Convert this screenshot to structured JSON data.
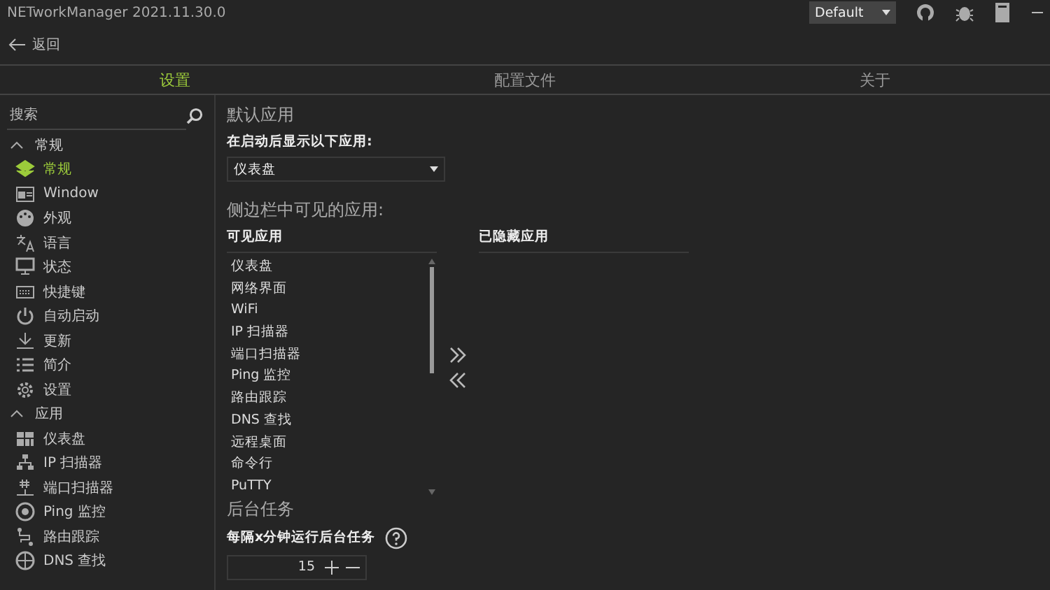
{
  "window": {
    "title": "NETworkManager 2021.11.30.0",
    "theme_dropdown": {
      "value": "Default"
    }
  },
  "back": {
    "label": "返回"
  },
  "tabs": [
    {
      "label": "设置",
      "selected": true
    },
    {
      "label": "配置文件",
      "selected": false
    },
    {
      "label": "关于",
      "selected": false
    }
  ],
  "sidebar": {
    "search": {
      "placeholder": "搜索"
    },
    "groups": [
      {
        "label": "常规",
        "expanded": true,
        "children": [
          {
            "label": "常规",
            "selected": true
          },
          {
            "label": "Window",
            "selected": false
          },
          {
            "label": "外观",
            "selected": false
          },
          {
            "label": "语言",
            "selected": false
          },
          {
            "label": "状态",
            "selected": false
          },
          {
            "label": "快捷键",
            "selected": false
          },
          {
            "label": "自动启动",
            "selected": false
          },
          {
            "label": "更新",
            "selected": false
          },
          {
            "label": "简介",
            "selected": false
          },
          {
            "label": "设置",
            "selected": false
          }
        ]
      },
      {
        "label": "应用",
        "expanded": true,
        "children": [
          {
            "label": "仪表盘",
            "selected": false
          },
          {
            "label": "IP 扫描器",
            "selected": false
          },
          {
            "label": "端口扫描器",
            "selected": false
          },
          {
            "label": "Ping 监控",
            "selected": false
          },
          {
            "label": "路由跟踪",
            "selected": false
          },
          {
            "label": "DNS 查找",
            "selected": false
          }
        ]
      }
    ]
  },
  "content": {
    "default_app": {
      "heading": "默认应用",
      "label": "在启动后显示以下应用:",
      "value": "仪表盘"
    },
    "sidebar_apps": {
      "heading": "侧边栏中可见的应用:",
      "visible_header": "可见应用",
      "hidden_header": "已隐藏应用",
      "visible": [
        "仪表盘",
        "网络界面",
        "WiFi",
        "IP 扫描器",
        "端口扫描器",
        "Ping 监控",
        "路由跟踪",
        "DNS 查找",
        "远程桌面",
        "命令行",
        "PuTTY"
      ]
    },
    "background": {
      "heading": "后台任务",
      "label": "每隔x分钟运行后台任务",
      "value": "15"
    }
  }
}
